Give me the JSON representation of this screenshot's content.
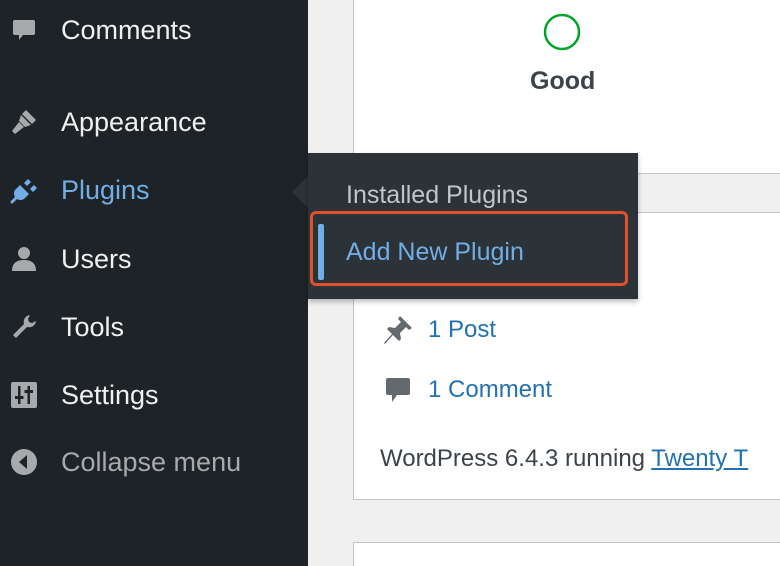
{
  "sidebar": {
    "items": [
      {
        "label": "Comments",
        "icon": "comment-icon"
      },
      {
        "label": "Appearance",
        "icon": "paintbrush-icon"
      },
      {
        "label": "Plugins",
        "icon": "plug-icon",
        "current": true
      },
      {
        "label": "Users",
        "icon": "user-icon"
      },
      {
        "label": "Tools",
        "icon": "wrench-icon"
      },
      {
        "label": "Settings",
        "icon": "sliders-icon"
      },
      {
        "label": "Collapse menu",
        "icon": "collapse-arrow-icon"
      }
    ]
  },
  "flyout": {
    "installed_label": "Installed Plugins",
    "add_new_label": "Add New Plugin"
  },
  "site_health": {
    "status_label": "Good"
  },
  "at_a_glance": {
    "posts_label": "1 Post",
    "comments_label": "1 Comment",
    "version_text": "WordPress 6.4.3 running ",
    "theme_link": "Twenty T"
  },
  "colors": {
    "sidebar_bg": "#1d2327",
    "accent": "#72aee6",
    "link": "#2271b1",
    "highlight": "#e2502b",
    "good": "#00a32a"
  }
}
